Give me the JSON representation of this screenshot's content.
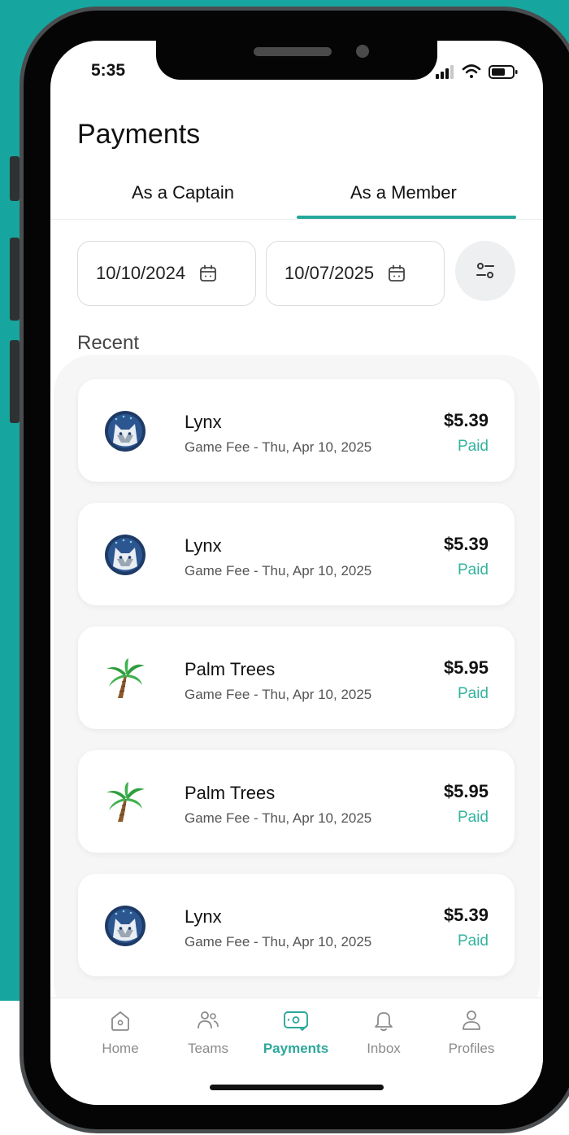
{
  "status_bar": {
    "time": "5:35"
  },
  "header": {
    "title": "Payments"
  },
  "tabs": [
    {
      "label": "As a Captain",
      "active": false
    },
    {
      "label": "As a Member",
      "active": true
    }
  ],
  "date_filter": {
    "start_date": "10/10/2024",
    "end_date": "10/07/2025",
    "filter_icon": "sliders-icon",
    "calendar_icon": "calendar-icon"
  },
  "section": {
    "label": "Recent"
  },
  "payments": [
    {
      "team": "Lynx",
      "avatar": "lynx-logo",
      "description": "Game Fee - Thu, Apr 10, 2025",
      "amount": "$5.39",
      "status": "Paid"
    },
    {
      "team": "Lynx",
      "avatar": "lynx-logo",
      "description": "Game Fee - Thu, Apr 10, 2025",
      "amount": "$5.39",
      "status": "Paid"
    },
    {
      "team": "Palm Trees",
      "avatar": "palm-tree-icon",
      "description": "Game Fee - Thu, Apr 10, 2025",
      "amount": "$5.95",
      "status": "Paid"
    },
    {
      "team": "Palm Trees",
      "avatar": "palm-tree-icon",
      "description": "Game Fee - Thu, Apr 10, 2025",
      "amount": "$5.95",
      "status": "Paid"
    },
    {
      "team": "Lynx",
      "avatar": "lynx-logo",
      "description": "Game Fee - Thu, Apr 10, 2025",
      "amount": "$5.39",
      "status": "Paid"
    }
  ],
  "nav": [
    {
      "label": "Home",
      "icon": "home-icon",
      "active": false
    },
    {
      "label": "Teams",
      "icon": "people-icon",
      "active": false
    },
    {
      "label": "Payments",
      "icon": "payment-icon",
      "active": true
    },
    {
      "label": "Inbox",
      "icon": "bell-icon",
      "active": false
    },
    {
      "label": "Profiles",
      "icon": "user-icon",
      "active": false
    }
  ],
  "colors": {
    "background": "#17a69f",
    "accent": "#24a89c",
    "paid_status": "#33b39f",
    "nav_active": "#2ca79a"
  }
}
